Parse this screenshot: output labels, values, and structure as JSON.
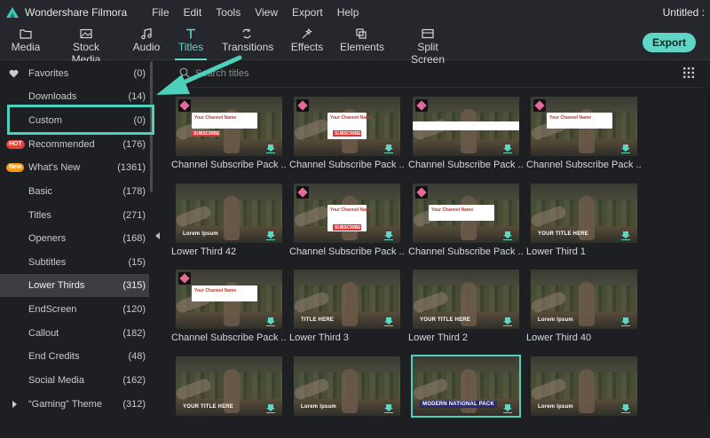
{
  "window": {
    "app_name": "Wondershare Filmora",
    "title": "Untitled :"
  },
  "menu": [
    "File",
    "Edit",
    "Tools",
    "View",
    "Export",
    "Help"
  ],
  "toolbar": {
    "tabs": [
      {
        "label": "Media",
        "icon": "folder-icon"
      },
      {
        "label": "Stock Media",
        "icon": "stock-media-icon"
      },
      {
        "label": "Audio",
        "icon": "music-icon"
      },
      {
        "label": "Titles",
        "icon": "titles-icon",
        "active": true
      },
      {
        "label": "Transitions",
        "icon": "transitions-icon"
      },
      {
        "label": "Effects",
        "icon": "effects-icon"
      },
      {
        "label": "Elements",
        "icon": "elements-icon"
      },
      {
        "label": "Split Screen",
        "icon": "split-screen-icon"
      }
    ],
    "export_label": "Export"
  },
  "sidebar": {
    "items": [
      {
        "label": "Favorites",
        "count": "(0)",
        "icon": "heart-icon"
      },
      {
        "label": "Downloads",
        "count": "(14)"
      },
      {
        "label": "Custom",
        "count": "(0)"
      },
      {
        "label": "Recommended",
        "count": "(176)",
        "badge": "HOT"
      },
      {
        "label": "What's New",
        "count": "(1361)",
        "badge": "New"
      },
      {
        "label": "Basic",
        "count": "(178)"
      },
      {
        "label": "Titles",
        "count": "(271)"
      },
      {
        "label": "Openers",
        "count": "(168)"
      },
      {
        "label": "Subtitles",
        "count": "(15)"
      },
      {
        "label": "Lower Thirds",
        "count": "(315)",
        "selected": true
      },
      {
        "label": "EndScreen",
        "count": "(120)"
      },
      {
        "label": "Callout",
        "count": "(182)"
      },
      {
        "label": "End Credits",
        "count": "(48)"
      },
      {
        "label": "Social Media",
        "count": "(162)"
      },
      {
        "label": "“Gaming” Theme",
        "count": "(312)",
        "expandable": true
      }
    ]
  },
  "search": {
    "placeholder": "Search titles"
  },
  "grid": {
    "items": [
      {
        "name": "Channel Subscribe Pack ...",
        "premium": true,
        "overlay": "Your Channel Name",
        "sub": "SUBSCRIBE"
      },
      {
        "name": "Channel Subscribe Pack ...",
        "premium": true,
        "overlay": "Your Channel Name",
        "sub": "SUBSCRIBE"
      },
      {
        "name": "Channel Subscribe Pack ...",
        "premium": true,
        "overlay": "",
        "sub": ""
      },
      {
        "name": "Channel Subscribe Pack ...",
        "premium": true,
        "overlay": "Your Channel Name",
        "sub": ""
      },
      {
        "name": "Lower Third 42",
        "premium": false,
        "overlay": "Lorem Ipsum",
        "sub": ""
      },
      {
        "name": "Channel Subscribe Pack ...",
        "premium": true,
        "overlay": "Your Channel Name",
        "sub": "SUBSCRIBE"
      },
      {
        "name": "Channel Subscribe Pack ...",
        "premium": true,
        "overlay": "Your Channel Name",
        "sub": ""
      },
      {
        "name": "Lower Third 1",
        "premium": false,
        "overlay": "YOUR TITLE HERE",
        "sub": ""
      },
      {
        "name": "Channel Subscribe Pack ...",
        "premium": true,
        "overlay": "Your Channel Name",
        "sub": ""
      },
      {
        "name": "Lower Third 3",
        "premium": false,
        "overlay": "TITLE HERE",
        "sub": ""
      },
      {
        "name": "Lower Third 2",
        "premium": false,
        "overlay": "YOUR TITLE HERE",
        "sub": ""
      },
      {
        "name": "Lower Third 40",
        "premium": false,
        "overlay": "Lorem Ipsum",
        "sub": ""
      },
      {
        "name": "",
        "premium": false,
        "overlay": "YOUR TITLE HERE",
        "sub": ""
      },
      {
        "name": "",
        "premium": false,
        "overlay": "Lorem Ipsum",
        "sub": ""
      },
      {
        "name": "",
        "premium": false,
        "overlay": "MODERN NATIONAL PACK",
        "sub": "",
        "selected": true
      },
      {
        "name": "",
        "premium": false,
        "overlay": "Lorem Ipsum",
        "sub": ""
      }
    ]
  },
  "colors": {
    "accent": "#5fd6c6",
    "highlight": "#4dd0bc",
    "hot": "#e2413c",
    "new": "#f29a1a",
    "premium": "#e56a9a"
  }
}
